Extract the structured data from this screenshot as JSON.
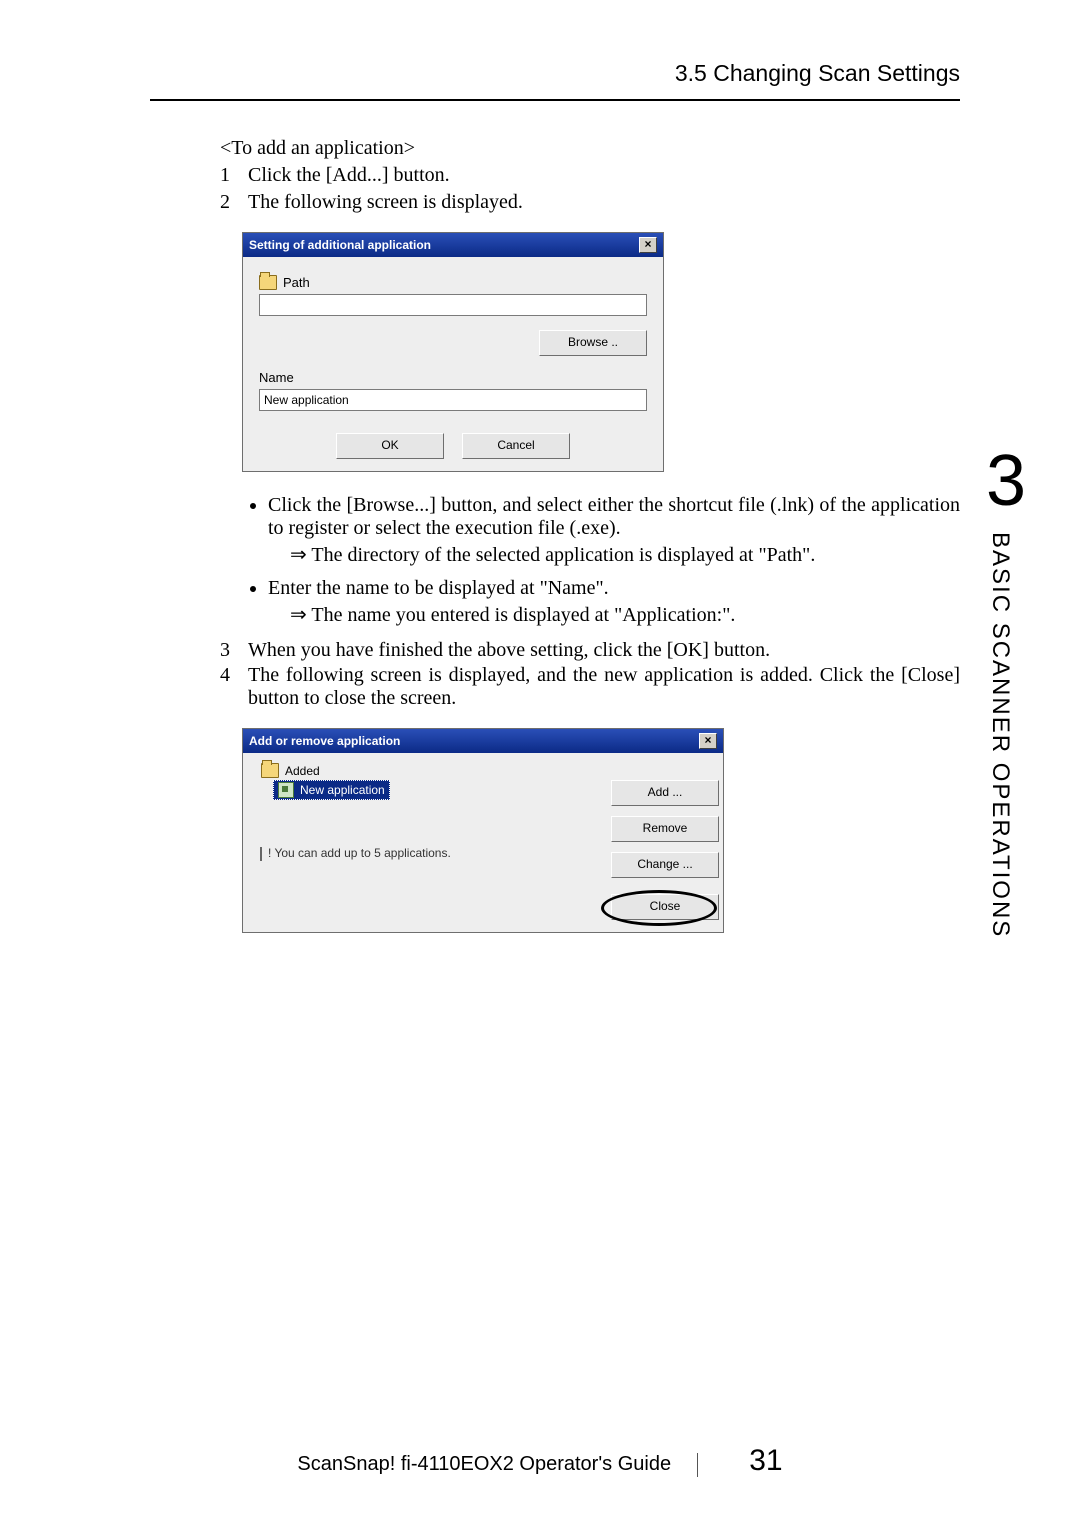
{
  "header": {
    "section_title": "3.5 Changing Scan Settings"
  },
  "body": {
    "intro": "<To add an application>",
    "step1_num": "1",
    "step1_text": "Click the [Add...] button.",
    "step2_num": "2",
    "step2_text": "The following screen is displayed.",
    "dialog1": {
      "title": "Setting of additional application",
      "close_glyph": "×",
      "path_label": "Path",
      "browse_btn": "Browse ..",
      "name_label": "Name",
      "name_value": "New application",
      "ok_btn": "OK",
      "cancel_btn": "Cancel"
    },
    "bullet1": "Click the [Browse...] button, and select either the shortcut file (.lnk) of the application to register or select the execution file (.exe).",
    "arrow1": "⇒ The directory of the selected application is displayed at \"Path\".",
    "bullet2": "Enter the name to be displayed at \"Name\".",
    "arrow2": "⇒ The name you entered is displayed at \"Application:\".",
    "step3_num": "3",
    "step3_text": "When you have finished the above setting, click the [OK] button.",
    "step4_num": "4",
    "step4_text": "The following screen is displayed, and the new application is added. Click the [Close] button to close the screen.",
    "dialog2": {
      "title": "Add or remove application",
      "close_glyph": "×",
      "added_label": "Added",
      "app_item": "New application",
      "add_btn": "Add ...",
      "remove_btn": "Remove",
      "change_btn": "Change ...",
      "close_btn": "Close",
      "note": "! You can add up to 5 applications."
    }
  },
  "side": {
    "chapter_num": "3",
    "chapter_title": "BASIC SCANNER OPERATIONS"
  },
  "footer": {
    "doc_title": "ScanSnap! fi-4110EOX2 Operator's Guide",
    "page_num": "31"
  }
}
